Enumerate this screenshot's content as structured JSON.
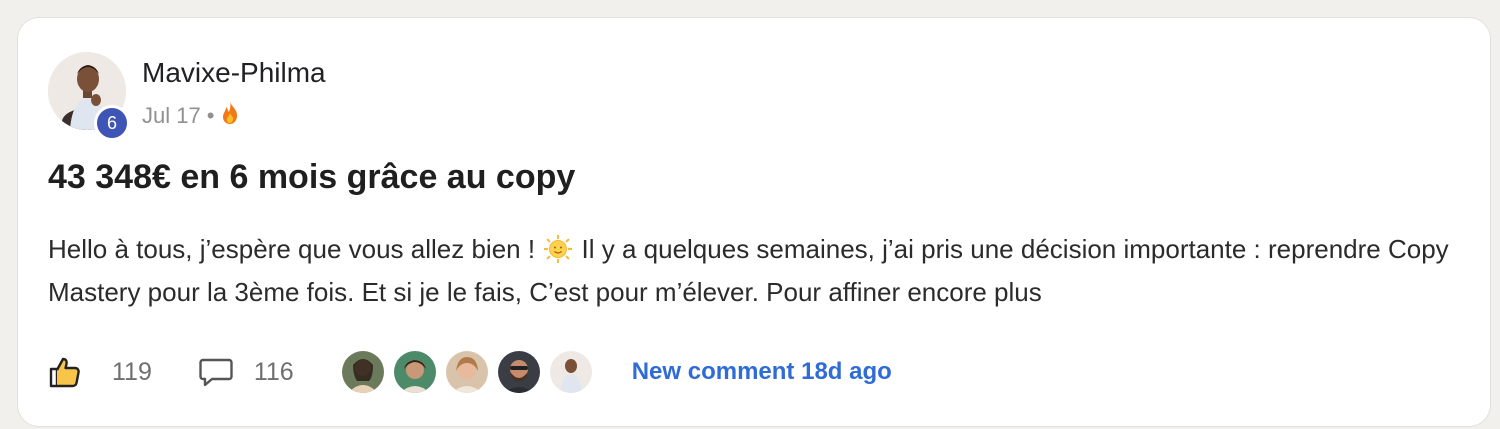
{
  "post": {
    "author": "Mavixe-Philma",
    "level": "6",
    "date": "Jul 17",
    "separator": "•",
    "meta_icon": "fire-icon",
    "title": "43 348€ en 6 mois grâce au copy",
    "excerpt_part1": "Hello à tous, j’espère que vous allez bien ! ",
    "excerpt_emoji": "sun-face-emoji",
    "excerpt_part2": " Il y a quelques semaines, j’ai pris une décision importante : reprendre Copy Mastery pour la 3ème fois. Et si je le fais, C’est pour m’élever. Pour affiner encore plus"
  },
  "footer": {
    "likes": "119",
    "comments": "116",
    "like_icon": "thumbs-up-icon",
    "comment_icon": "speech-bubble-icon",
    "commenter_avatars": 5,
    "new_comment_text": "New comment 18d ago"
  },
  "colors": {
    "accent_link": "#2f6cd6",
    "badge": "#3f55b5",
    "page_bg": "#f2f0ec",
    "card_bg": "#ffffff"
  }
}
